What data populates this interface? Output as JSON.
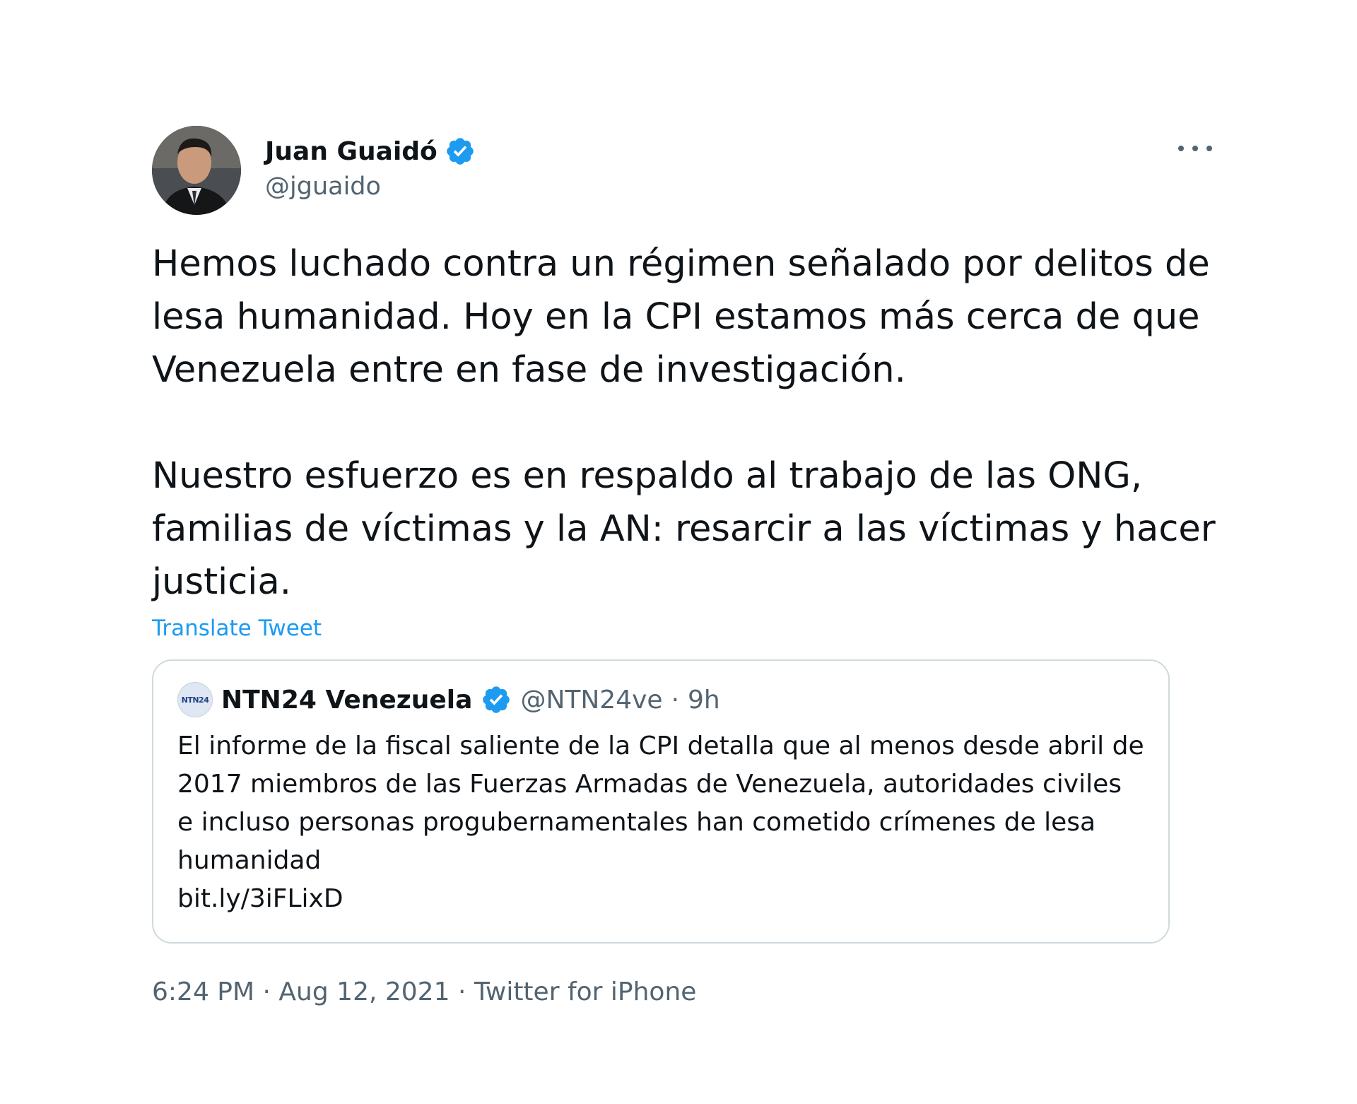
{
  "author": {
    "display_name": "Juan Guaidó",
    "handle": "@jguaido",
    "verified_icon": "verified-badge-icon",
    "avatar": "profile-photo"
  },
  "more_icon": "more-options-icon",
  "tweet": {
    "paragraphs": [
      "Hemos luchado contra un régimen señalado por delitos de lesa humanidad. Hoy en la CPI estamos más cerca de que Venezuela entre en fase de investigación.",
      "Nuestro esfuerzo es en respaldo al trabajo de las ONG, familias de víctimas y la AN: resarcir a las víctimas y hacer justicia."
    ],
    "translate_label": "Translate Tweet"
  },
  "quoted_tweet": {
    "display_name": "NTN24 Venezuela",
    "avatar_text": "NTN24",
    "handle": "@NTN24ve",
    "separator": "·",
    "time": "9h",
    "text": "El informe de la fiscal saliente de la CPI detalla que al menos desde abril de 2017 miembros de las Fuerzas Armadas de Venezuela, autoridades civiles e incluso personas progubernamentales han cometido crímenes de lesa humanidad",
    "link": "bit.ly/3iFLixD"
  },
  "meta": {
    "time": "6:24 PM",
    "separator": "·",
    "date": "Aug 12, 2021",
    "source": "Twitter for iPhone"
  },
  "colors": {
    "accent": "#1d9bf0",
    "text_primary": "#0f1419",
    "text_secondary": "#536471",
    "border": "#cfd9de"
  }
}
